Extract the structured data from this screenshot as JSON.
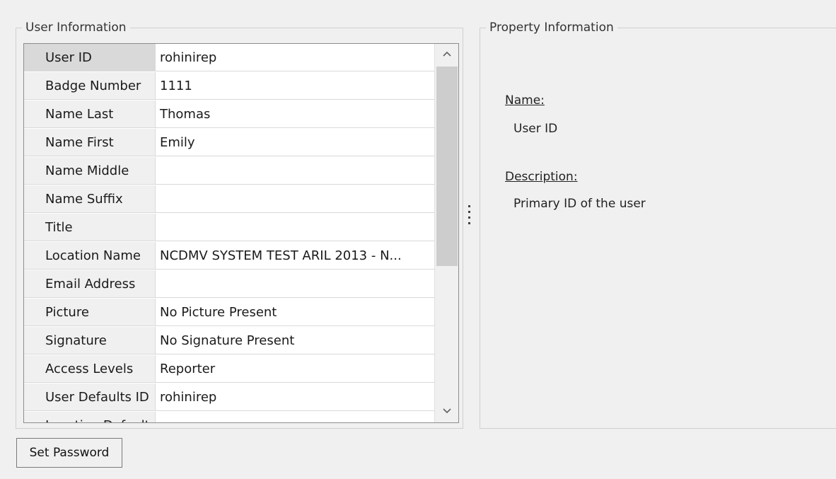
{
  "user_group": {
    "title": "User Information",
    "rows": [
      {
        "name": "User ID",
        "value": "rohinirep"
      },
      {
        "name": "Badge Number",
        "value": "1111"
      },
      {
        "name": "Name Last",
        "value": "Thomas"
      },
      {
        "name": "Name First",
        "value": "Emily"
      },
      {
        "name": "Name Middle",
        "value": ""
      },
      {
        "name": "Name Suffix",
        "value": ""
      },
      {
        "name": "Title",
        "value": ""
      },
      {
        "name": "Location Name",
        "value": "NCDMV SYSTEM TEST ARIL 2013 - N..."
      },
      {
        "name": "Email Address",
        "value": ""
      },
      {
        "name": "Picture",
        "value": "No Picture Present"
      },
      {
        "name": "Signature",
        "value": "No Signature Present"
      },
      {
        "name": "Access Levels",
        "value": "Reporter"
      },
      {
        "name": "User Defaults ID",
        "value": "rohinirep"
      },
      {
        "name": "Location Default",
        "value": ""
      }
    ],
    "scroll_up_icon": "chevron-up-icon",
    "scroll_down_icon": "chevron-down-icon"
  },
  "property_group": {
    "title": "Property Information",
    "name_label": "Name:",
    "name_value": "User ID",
    "description_label": "Description:",
    "description_value": "Primary ID of the user"
  },
  "set_password_label": "Set Password"
}
